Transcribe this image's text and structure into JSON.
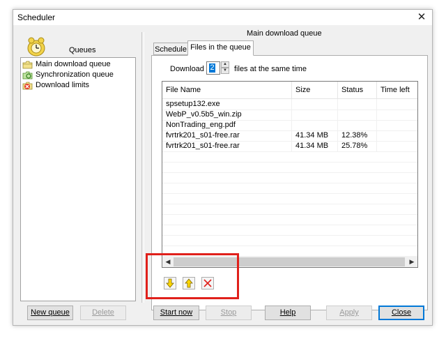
{
  "window": {
    "title": "Scheduler",
    "close_glyph": "✕"
  },
  "sidebar": {
    "heading": "Queues",
    "items": [
      {
        "label": "Main download queue",
        "icon": "queue-folder-icon"
      },
      {
        "label": "Synchronization queue",
        "icon": "sync-queue-icon"
      },
      {
        "label": "Download limits",
        "icon": "download-limits-icon"
      }
    ],
    "new_queue_label": "New queue",
    "delete_label": "Delete"
  },
  "main": {
    "title": "Main download queue",
    "tabs": [
      {
        "label": "Schedule"
      },
      {
        "label": "Files in the queue"
      }
    ],
    "download_label": "Download",
    "concurrent_value": "2",
    "files_label": "files at the same time",
    "table": {
      "columns": [
        "File Name",
        "Size",
        "Status",
        "Time left"
      ],
      "rows": [
        {
          "name": "spsetup132.exe",
          "size": "",
          "status": "",
          "time": ""
        },
        {
          "name": "WebP_v0.5b5_win.zip",
          "size": "",
          "status": "",
          "time": ""
        },
        {
          "name": "NonTrading_eng.pdf",
          "size": "",
          "status": "",
          "time": ""
        },
        {
          "name": "fvrtrk201_s01-free.rar",
          "size": "41.34  MB",
          "status": "12.38%",
          "time": ""
        },
        {
          "name": "fvrtrk201_s01-free.rar",
          "size": "41.34  MB",
          "status": "25.78%",
          "time": ""
        }
      ]
    },
    "tools": [
      "move-down-icon",
      "move-up-icon",
      "remove-icon"
    ]
  },
  "buttons": {
    "start_now": "Start now",
    "stop": "Stop",
    "help": "Help",
    "apply": "Apply",
    "close": "Close"
  },
  "colors": {
    "highlight": "#e0201b",
    "selection": "#0078d7",
    "arrow_yellow": "#ffd800"
  }
}
